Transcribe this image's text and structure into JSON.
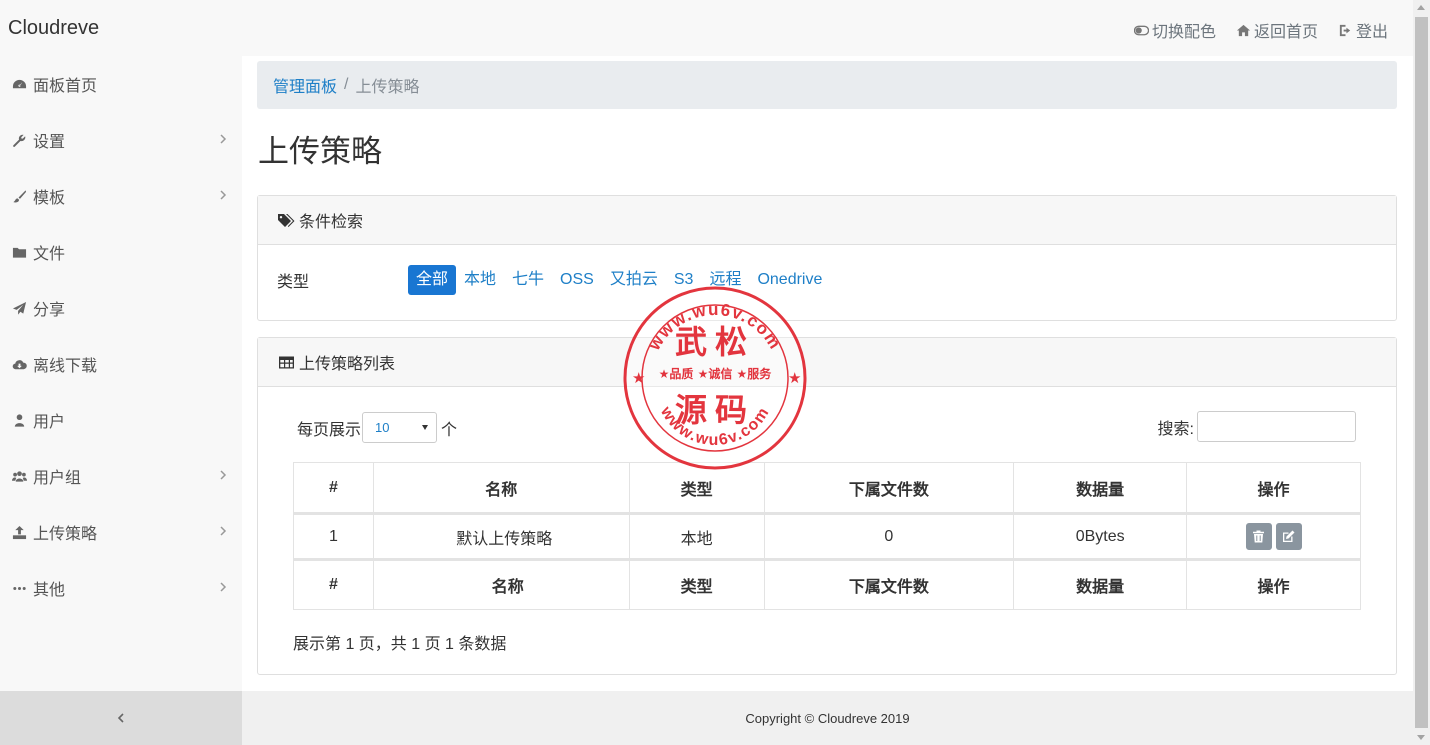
{
  "app": {
    "brand": "Cloudreve"
  },
  "topnav": [
    {
      "label": "切换配色",
      "icon": "toggle-icon"
    },
    {
      "label": "返回首页",
      "icon": "home-icon"
    },
    {
      "label": "登出",
      "icon": "sign-out-icon"
    }
  ],
  "sidebar": {
    "items": [
      {
        "label": "面板首页",
        "icon": "dashboard-icon",
        "has_children": false
      },
      {
        "label": "设置",
        "icon": "wrench-icon",
        "has_children": true
      },
      {
        "label": "模板",
        "icon": "paint-brush-icon",
        "has_children": true
      },
      {
        "label": "文件",
        "icon": "folder-icon",
        "has_children": false
      },
      {
        "label": "分享",
        "icon": "paper-plane-icon",
        "has_children": false
      },
      {
        "label": "离线下载",
        "icon": "cloud-download-icon",
        "has_children": false
      },
      {
        "label": "用户",
        "icon": "user-icon",
        "has_children": false
      },
      {
        "label": "用户组",
        "icon": "users-icon",
        "has_children": true
      },
      {
        "label": "上传策略",
        "icon": "upload-icon",
        "has_children": true
      },
      {
        "label": "其他",
        "icon": "ellipsis-icon",
        "has_children": true
      }
    ],
    "collapse_icon": "chevron-left-icon"
  },
  "breadcrumb": {
    "parent": "管理面板",
    "separator": "/",
    "current": "上传策略"
  },
  "page_title": "上传策略",
  "filter_card": {
    "title": "条件检索",
    "type_label": "类型",
    "options": [
      "全部",
      "本地",
      "七牛",
      "OSS",
      "又拍云",
      "S3",
      "远程",
      "Onedrive"
    ],
    "selected": "全部"
  },
  "list_card": {
    "title": "上传策略列表",
    "length_prefix": "每页展示",
    "length_value": "10",
    "length_suffix": "个",
    "search_label": "搜索:",
    "search_value": "",
    "columns": [
      "#",
      "名称",
      "类型",
      "下属文件数",
      "数据量",
      "操作"
    ],
    "rows": [
      {
        "id": "1",
        "name": "默认上传策略",
        "type": "本地",
        "files": "0",
        "size": "0Bytes"
      }
    ],
    "info": "展示第 1 页，共 1 页 1 条数据"
  },
  "footer": {
    "copyright": "Copyright © Cloudreve 2019"
  },
  "watermark": {
    "top_text": "www.wu6v.com",
    "main_top": "武松",
    "tagline": "★品质 ★诚信 ★服务",
    "main_bottom": "源码",
    "bottom_text": "www.wu6v.com",
    "color": "#e0202a"
  },
  "colors": {
    "accent": "#1e7fc7",
    "active": "#1976d2"
  }
}
